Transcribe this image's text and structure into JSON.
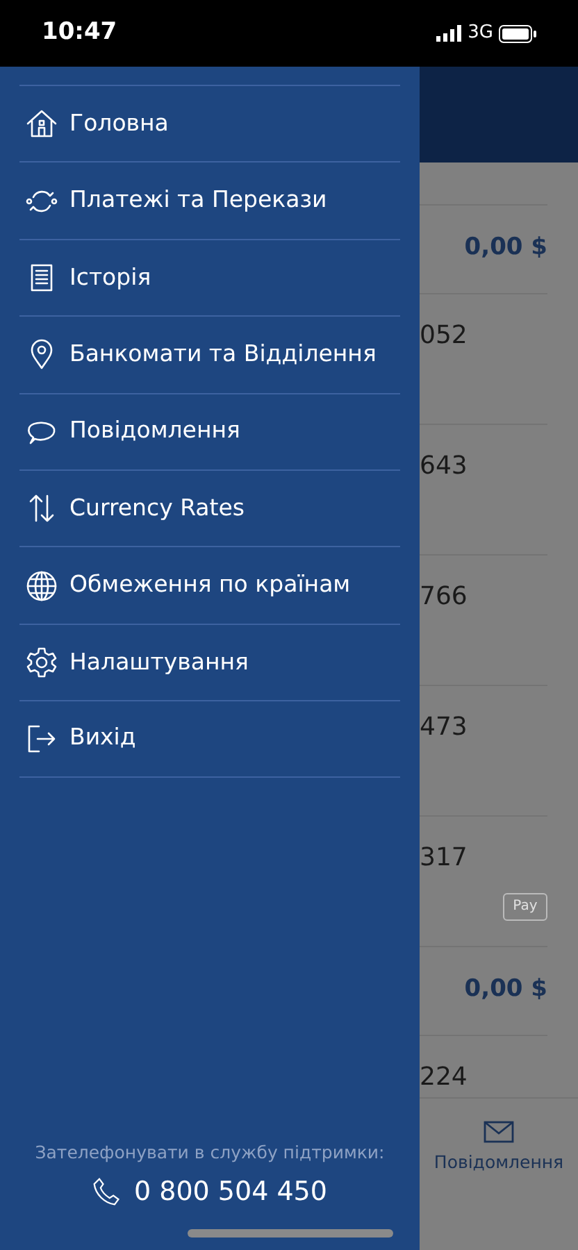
{
  "status_bar": {
    "time": "10:47",
    "network": "3G"
  },
  "drawer": {
    "items": [
      {
        "label": "Головна"
      },
      {
        "label": "Платежі та Перекази"
      },
      {
        "label": "Історія"
      },
      {
        "label": "Банкомати та Відділення"
      },
      {
        "label": "Повідомлення"
      },
      {
        "label": "Currency Rates"
      },
      {
        "label": "Обмеження по країнам"
      },
      {
        "label": "Налаштування"
      },
      {
        "label": "Вихід"
      }
    ],
    "support": {
      "label": "Зателефонувати в службу підтримки:",
      "phone": "0 800 504 450"
    }
  },
  "background": {
    "rows": [
      {
        "kind": "balance",
        "text": "0,00 $"
      },
      {
        "kind": "card",
        "text": "052"
      },
      {
        "kind": "card",
        "text": "643"
      },
      {
        "kind": "card",
        "text": "766"
      },
      {
        "kind": "card",
        "text": "473"
      },
      {
        "kind": "card",
        "text": "317",
        "badge": "Pay"
      },
      {
        "kind": "balance",
        "text": "0,00 $"
      },
      {
        "kind": "card",
        "text": "224"
      }
    ],
    "tab_bar": {
      "label": "Повідомлення"
    }
  }
}
